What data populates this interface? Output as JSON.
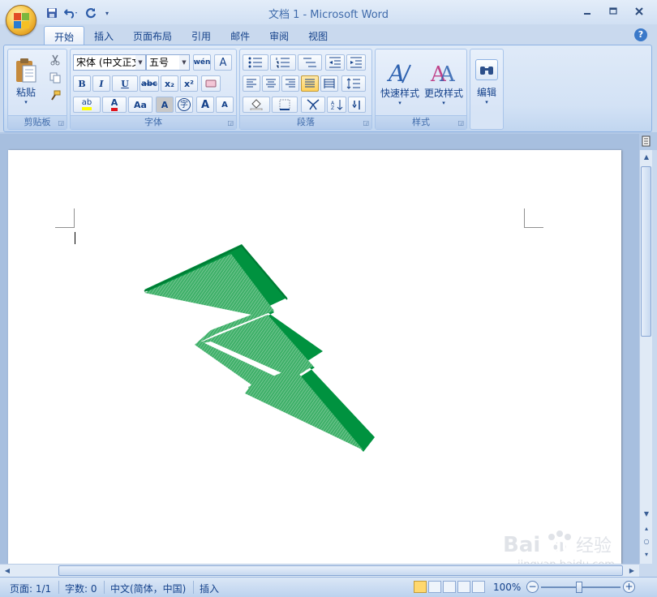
{
  "window": {
    "title": "文档 1 - Microsoft Word"
  },
  "tabs": [
    "开始",
    "插入",
    "页面布局",
    "引用",
    "邮件",
    "审阅",
    "视图"
  ],
  "ribbon": {
    "clipboard": {
      "paste_label": "粘贴",
      "group_label": "剪贴板"
    },
    "font": {
      "font_name": "宋体 (中文正文",
      "font_size": "五号",
      "bold": "B",
      "italic": "I",
      "underline": "U",
      "strike": "abc",
      "subscript": "x₂",
      "superscript": "x²",
      "highlight": "ab",
      "color": "A",
      "change_case": "Aa",
      "char_shading": "A",
      "enclose": "字",
      "grow": "A",
      "shrink": "A",
      "phonetic": "wén",
      "border": "A",
      "group_label": "字体"
    },
    "paragraph": {
      "group_label": "段落"
    },
    "styles": {
      "quick_styles": "快速样式",
      "change_styles": "更改样式",
      "group_label": "样式"
    },
    "editing": {
      "label": "编辑"
    }
  },
  "status": {
    "page": "页面: 1/1",
    "words": "字数: 0",
    "language": "中文(简体，中国)",
    "mode": "插入",
    "zoom": "100%"
  },
  "watermark": {
    "brand": "Bai",
    "brand2": "du",
    "jingyan": "经验",
    "url": "jingyan.baidu.com"
  },
  "colors": {
    "shape_fill": "#00923f",
    "shape_side": "#007a34",
    "ribbon_text": "#15428b"
  }
}
